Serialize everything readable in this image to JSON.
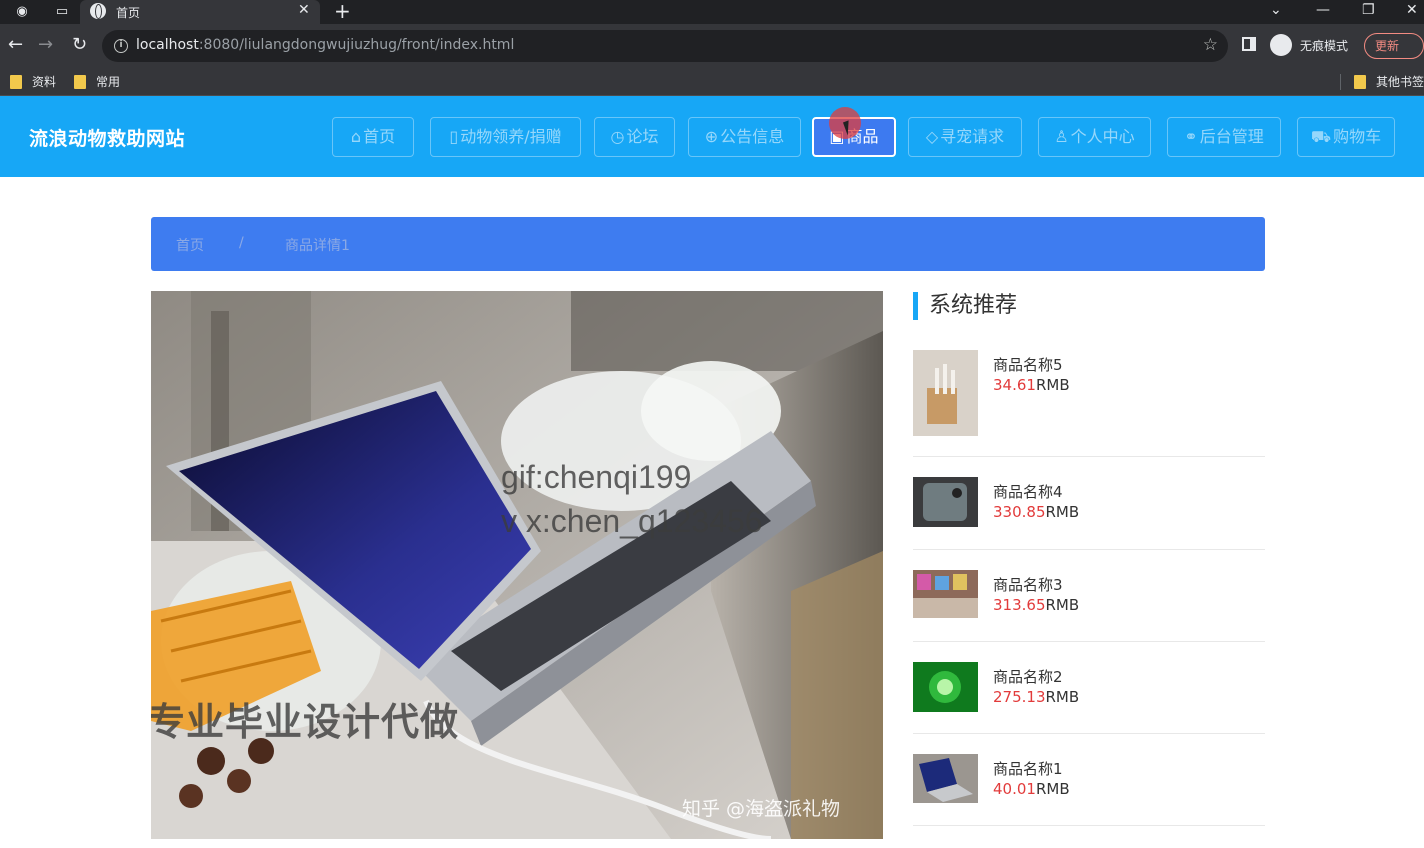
{
  "browser": {
    "tab_title": "首页",
    "url_host": "localhost",
    "url_rest": ":8080/liulangdongwujiuzhug/front/index.html",
    "incognito_label": "无痕模式",
    "update_label": "更新",
    "bookmarks": [
      "资料",
      "常用",
      "其他书签"
    ]
  },
  "site": {
    "title": "流浪动物救助网站",
    "nav": [
      {
        "icon": "⌂",
        "label": "首页"
      },
      {
        "icon": "▯",
        "label": "动物领养/捐赠"
      },
      {
        "icon": "◷",
        "label": "论坛"
      },
      {
        "icon": "⊕",
        "label": "公告信息"
      },
      {
        "icon": "▣",
        "label": "商品"
      },
      {
        "icon": "◇",
        "label": "寻宠请求"
      },
      {
        "icon": "♙",
        "label": "个人中心"
      },
      {
        "icon": "⚭",
        "label": "后台管理"
      },
      {
        "icon": "⛟",
        "label": "购物车"
      }
    ],
    "active_nav_index": 4
  },
  "breadcrumb": {
    "home": "首页",
    "separator": "/",
    "current": "商品详情1"
  },
  "product_image": {
    "watermark_line1": "gif:chenqi199",
    "watermark_line2": "v x:chen_q123456",
    "overlay_text": "专业毕业设计代做",
    "credit": "知乎 @海盗派礼物"
  },
  "recommend": {
    "title": "系统推荐",
    "currency": "RMB",
    "items": [
      {
        "name": "商品名称5",
        "price": "34.61"
      },
      {
        "name": "商品名称4",
        "price": "330.85"
      },
      {
        "name": "商品名称3",
        "price": "313.65"
      },
      {
        "name": "商品名称2",
        "price": "275.13"
      },
      {
        "name": "商品名称1",
        "price": "40.01"
      }
    ]
  },
  "colors": {
    "header_bg": "#17a7f6",
    "breadcrumb_bg": "#3e7cf0",
    "price": "#e23b3b"
  }
}
